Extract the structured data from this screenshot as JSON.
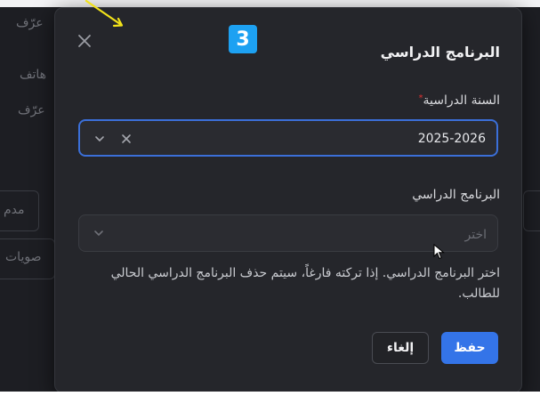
{
  "background": {
    "texts": [
      "عرّف",
      "هاتف",
      "عرّف",
      "مدم",
      "صويات"
    ]
  },
  "modal": {
    "title": "البرنامج الدراسي",
    "step_number": "3",
    "close_icon": "close-icon",
    "fields": [
      {
        "label": "السنة الدراسية",
        "required_mark": "*",
        "value": "2025-2026",
        "state": "focused"
      },
      {
        "label": "البرنامج الدراسي",
        "placeholder": "اختر",
        "value": ""
      }
    ],
    "help_text": "اختر البرنامج الدراسي. إذا تركته فارغاً، سيتم حذف البرنامج الدراسي الحالي للطالب.",
    "buttons": {
      "save": "حفظ",
      "cancel": "إلغاء"
    }
  },
  "colors": {
    "accent": "#3474e8",
    "badge": "#1da1f2",
    "focus_border": "#3b6fd8",
    "modal_bg": "#25262b"
  }
}
